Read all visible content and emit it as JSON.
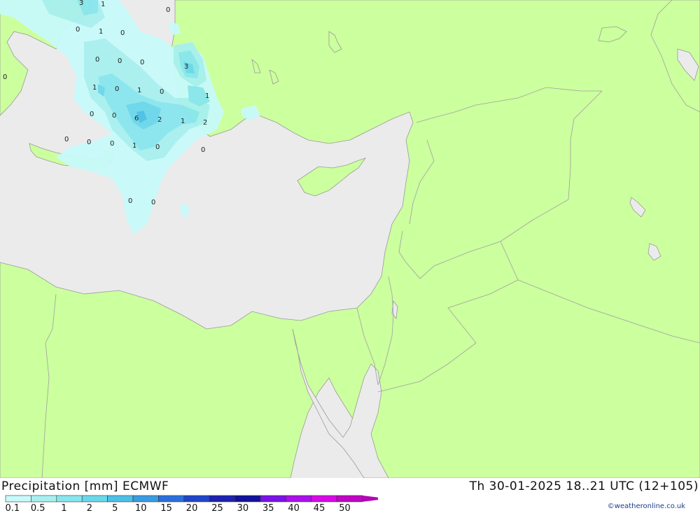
{
  "title": {
    "left": "Precipitation [mm] ECMWF",
    "right": "Th 30-01-2025 18..21 UTC (12+105)"
  },
  "credit": "©weatheronline.co.uk",
  "colors": {
    "land": "#ccff9e",
    "sea": "#ebebeb",
    "border": "#a0a0a0"
  },
  "legend": {
    "labels": [
      "0.1",
      "0.5",
      "1",
      "2",
      "5",
      "10",
      "15",
      "20",
      "25",
      "30",
      "35",
      "40",
      "45",
      "50"
    ],
    "colors": [
      "#c8fafa",
      "#a8f0f0",
      "#88e6ee",
      "#6ad8ea",
      "#4cc0e6",
      "#3a9ce0",
      "#2a70dc",
      "#2046c8",
      "#1e22b0",
      "#12129a",
      "#7a12e6",
      "#aa10ea",
      "#d60ae6",
      "#c006c2"
    ]
  },
  "precip_values": [
    {
      "v": "3"
    },
    {
      "v": "1"
    },
    {
      "v": "0"
    },
    {
      "v": "0"
    },
    {
      "v": "1"
    },
    {
      "v": "0"
    },
    {
      "v": "0"
    },
    {
      "v": "0"
    },
    {
      "v": "0"
    },
    {
      "v": "3"
    },
    {
      "v": "1"
    },
    {
      "v": "0"
    },
    {
      "v": "1"
    },
    {
      "v": "0"
    },
    {
      "v": "1"
    },
    {
      "v": "0"
    },
    {
      "v": "0"
    },
    {
      "v": "6"
    },
    {
      "v": "2"
    },
    {
      "v": "1"
    },
    {
      "v": "2"
    },
    {
      "v": "0"
    },
    {
      "v": "0"
    },
    {
      "v": "0"
    },
    {
      "v": "1"
    },
    {
      "v": "0"
    },
    {
      "v": "0"
    },
    {
      "v": "0"
    },
    {
      "v": "0"
    },
    {
      "v": "0"
    }
  ]
}
